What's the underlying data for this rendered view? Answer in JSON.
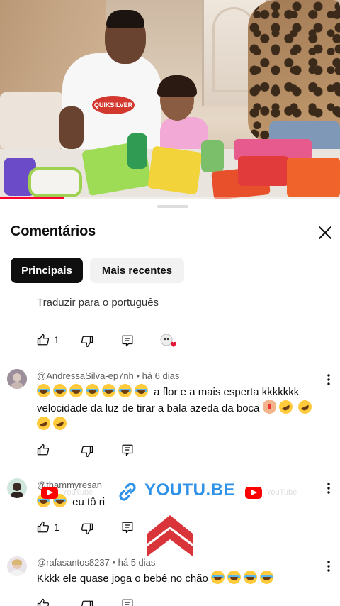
{
  "video": {
    "shirt_logo": "QUIKSILVER",
    "progress": 0.19,
    "progress_color": "#ff0033"
  },
  "sheet": {
    "title": "Comentários",
    "close_icon": "close-icon",
    "chips": [
      {
        "label": "Principais",
        "active": true
      },
      {
        "label": "Mais recentes",
        "active": false
      }
    ]
  },
  "previous_comment": {
    "translate_label": "Traduzir para o português",
    "like_count": "1"
  },
  "comments": [
    {
      "handle": "@AndressaSilva-ep7nh",
      "time": "há 6 dias",
      "text_a": "a flor e a mais esperta kkkkkkk velocidade da luz de tirar a bala azeda da boca",
      "like_count": ""
    },
    {
      "handle": "@thammyresan",
      "time": "",
      "text_a": "eu tô ri",
      "like_count": "1"
    },
    {
      "handle": "@rafasantos8237",
      "time": "há 5 dias",
      "text_a": "Kkkk ele quase joga o bebê no chão",
      "like_count": ""
    }
  ],
  "watermark": {
    "text": "YOUTU.BE",
    "ghost_label": "YouTube",
    "color": "#2f92e8",
    "chevron_color": "#d9343a"
  }
}
